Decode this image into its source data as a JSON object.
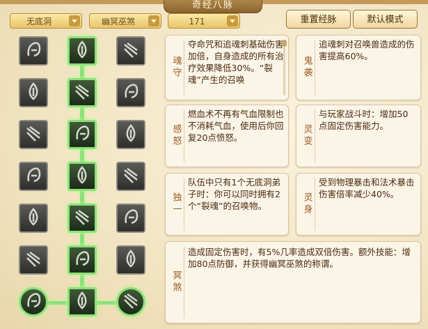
{
  "window": {
    "title": "奇经八脉"
  },
  "toolbar": {
    "dropdowns": [
      {
        "value": "无底洞"
      },
      {
        "value": "幽冥巫煞"
      },
      {
        "value": "171"
      }
    ],
    "reset_label": "重置经脉",
    "default_label": "默认模式"
  },
  "skill_grid": {
    "rows": [
      [
        "inactive",
        "active",
        "inactive"
      ],
      [
        "inactive",
        "active",
        "inactive"
      ],
      [
        "inactive",
        "active",
        "inactive"
      ],
      [
        "inactive",
        "active",
        "inactive"
      ],
      [
        "inactive",
        "active",
        "inactive"
      ],
      [
        "inactive",
        "active",
        "inactive"
      ],
      [
        "active",
        "active",
        "active"
      ]
    ],
    "icons": [
      [
        "claw-icon",
        "flame-icon",
        "crow-icon"
      ],
      [
        "fork-icon",
        "figure-icon",
        "tooth-icon"
      ],
      [
        "skull-icon",
        "warrior-icon",
        "spirit-icon"
      ],
      [
        "shout-icon",
        "swirl-icon",
        "ghost-icon"
      ],
      [
        "rune-icon",
        "slash-icon",
        "vortex-icon"
      ],
      [
        "spike-icon",
        "scroll-icon",
        "fang-icon"
      ],
      [
        "orb-icon",
        "demon-icon",
        "orb-icon"
      ]
    ]
  },
  "descriptions": [
    {
      "name": "魂守",
      "text": "夺命咒和追魂刺基础伤害加倍，自身造成的所有治疗效果降低30%。“裂魂”产生的召唤"
    },
    {
      "name": "鬼袭",
      "text": "追魂刺对召唤兽造成的伤害提高60%。"
    },
    {
      "name": "感怒",
      "text": "燃血术不再有气血限制也不消耗气血，使用后你回复20点愤怒。"
    },
    {
      "name": "灵变",
      "text": "与玩家战斗时：增加50点固定伤害能力。"
    },
    {
      "name": "独一",
      "text": "队伍中只有1个无底洞弟子时：你可以同时拥有2个“裂魂”的召唤物。"
    },
    {
      "name": "灵身",
      "text": "受到物理暴击和法术暴击伤害倍率减少40%。"
    },
    {
      "name": "冥煞",
      "text": "造成固定伤害时，有5%几率造成双倍伤害。额外技能：增加80点防御，并获得幽冥巫煞的称谓。"
    }
  ]
}
